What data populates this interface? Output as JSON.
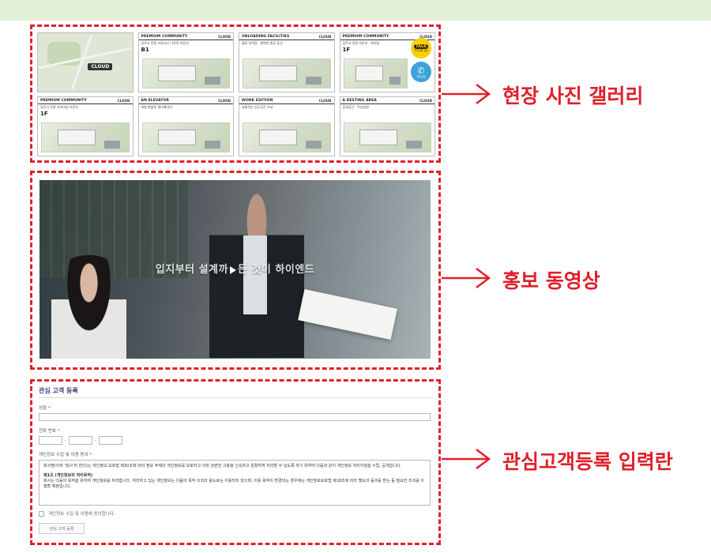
{
  "colors": {
    "accent": "#e0202a",
    "topbar": "#e3efd6",
    "form_title": "#3b3f7a"
  },
  "gallery": {
    "cards": [
      {
        "kind": "map",
        "pin": "CLOUD"
      },
      {
        "title": "PREMIUM COMMUNITY",
        "brand": "CLOUD",
        "sub": "입주사 전용 커뮤니티 다목적 라운지",
        "floor": "B1"
      },
      {
        "title": "UNLOADING FACILITIES",
        "brand": "CLOUD",
        "sub": "물류 하역장 · 완벽한 물류 동선",
        "floor": ""
      },
      {
        "title": "PREMIUM COMMUNITY",
        "brand": "CLOUD",
        "sub": "입주사 전용 라운지 · 회의실",
        "floor": "1F"
      },
      {
        "title": "PREMIUM COMMUNITY",
        "brand": "CLOUD",
        "sub": "입주사 전용 프리미엄 라운지",
        "floor": "1F"
      },
      {
        "title": "AN ELEVATOR",
        "brand": "CLOUD",
        "sub": "대형 화물용 엘리베이터",
        "floor": ""
      },
      {
        "title": "WORK EDITION",
        "brand": "CLOUD",
        "sub": "효율적인 업무공간 조성",
        "floor": ""
      },
      {
        "title": "A RESTING AREA",
        "brand": "CLOUD",
        "sub": "휴게공간 · 옥상정원",
        "floor": ""
      }
    ],
    "talk_label": "TALK",
    "talk_sub": "카카오톡 상담",
    "call_sub": "전화상담"
  },
  "video": {
    "caption_left": "입지부터 설계까",
    "caption_right": "든 것이 하이엔드"
  },
  "form": {
    "title": "관심 고객 등록",
    "name_label": "성함",
    "phone_label": "전화 번호",
    "phone_sep": "-",
    "consent_label": "개인정보 수집 및 이용 동의",
    "consent_text_1": "회사명(이하 '회사'라 한다)는 개인정보 보호법 제30조에 따라 정보 주체의 개인정보를 보호하고 이와 관련한 고충을 신속하고 원활하게 처리할 수 있도록 하기 위하여 다음과 같이 개인정보 처리지침을 수립, 공개합니다.",
    "consent_heading": "제1조 (개인정보의 처리목적)",
    "consent_text_2": "회사는 다음의 목적을 위하여 개인정보를 처리합니다. 처리하고 있는 개인정보는 다음의 목적 이외의 용도로는 이용되지 않으며, 이용 목적이 변경되는 경우에는 개인정보보호법 제18조에 따라 별도의 동의를 받는 등 필요한 조치를 이행할 예정입니다.",
    "agree_label": "개인정보 수집 및 이용에 동의합니다.",
    "submit_label": "관심 고객 등록",
    "required_mark": "*"
  },
  "callouts": {
    "gallery": "현장 사진 갤러리",
    "video": "홍보 동영상",
    "form": "관심고객등록 입력란"
  }
}
